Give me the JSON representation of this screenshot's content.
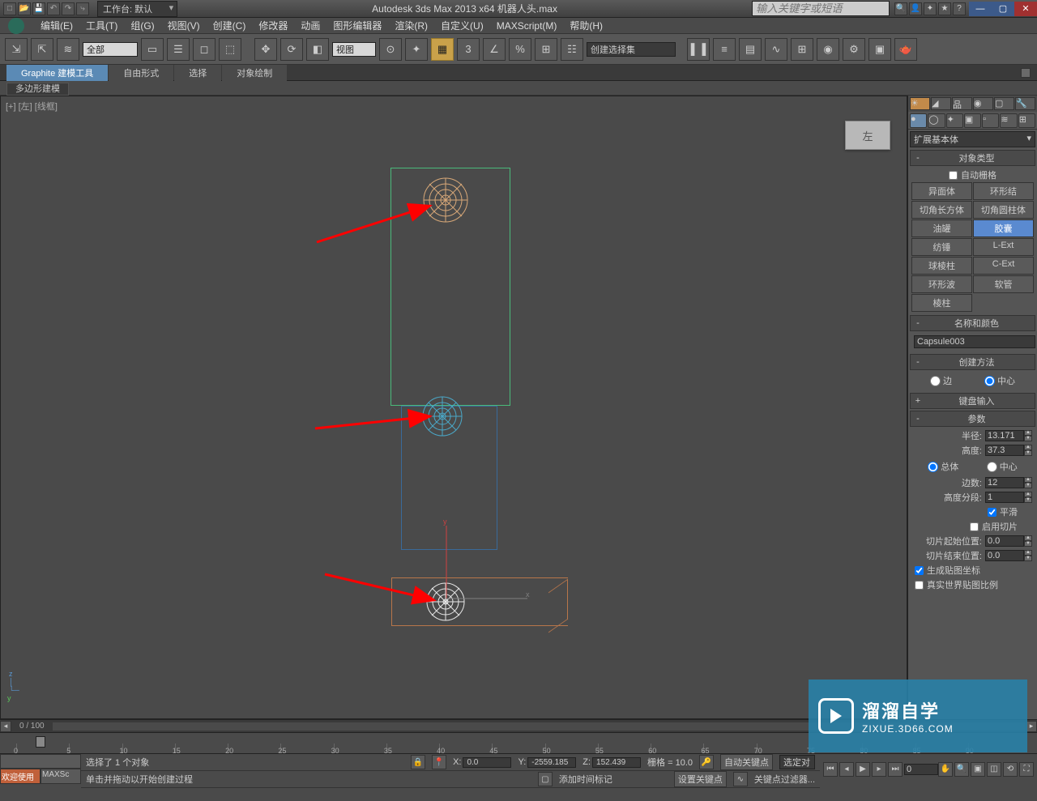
{
  "title": "Autodesk 3ds Max  2013 x64     机器人头.max",
  "workspace_label": "工作台: 默认",
  "search_placeholder": "输入关键字或短语",
  "menus": [
    "编辑(E)",
    "工具(T)",
    "组(G)",
    "视图(V)",
    "创建(C)",
    "修改器",
    "动画",
    "图形编辑器",
    "渲染(R)",
    "自定义(U)",
    "MAXScript(M)",
    "帮助(H)"
  ],
  "toolbar": {
    "filter_all": "全部",
    "viewport_drop": "视图",
    "named_sel": "创建选择集"
  },
  "ribbon_tabs": [
    "Graphite 建模工具",
    "自由形式",
    "选择",
    "对象绘制"
  ],
  "ribbon_sub": "多边形建模",
  "viewport_label": "[+] [左] [线框]",
  "viewcube_label": "左",
  "command_panel": {
    "category_drop": "扩展基本体",
    "rollouts": {
      "object_type": {
        "title": "对象类型",
        "autogrid": "自动栅格"
      },
      "name_color": {
        "title": "名称和颜色"
      },
      "create_method": {
        "title": "创建方法",
        "edge": "边",
        "center": "中心"
      },
      "keyboard": {
        "title": "键盘输入"
      },
      "params": {
        "title": "参数"
      }
    },
    "primitives": [
      [
        "异面体",
        "环形结"
      ],
      [
        "切角长方体",
        "切角圆柱体"
      ],
      [
        "油罐",
        "胶囊"
      ],
      [
        "纺锤",
        "L-Ext"
      ],
      [
        "球棱柱",
        "C-Ext"
      ],
      [
        "环形波",
        "软管"
      ],
      [
        "棱柱",
        ""
      ]
    ],
    "object_name": "Capsule003",
    "params": {
      "radius_label": "半径:",
      "radius": "13.171",
      "height_label": "高度:",
      "height": "37.3",
      "overall": "总体",
      "centers": "中心",
      "sides_label": "边数:",
      "sides": "12",
      "hsegs_label": "高度分段:",
      "hsegs": "1",
      "smooth": "平滑",
      "slice_on": "启用切片",
      "slice_from_label": "切片起始位置:",
      "slice_from": "0.0",
      "slice_to_label": "切片结束位置:",
      "slice_to": "0.0",
      "gen_uv": "生成贴图坐标",
      "real_world": "真实世界贴图比例"
    }
  },
  "trackbar_pos": "0 / 100",
  "status": {
    "line1": "选择了 1 个对象",
    "line2": "单击并拖动以开始创建过程",
    "x": "0.0",
    "y": "-2559.185",
    "z": "152.439",
    "grid": "栅格 = 10.0",
    "autokey": "自动关键点",
    "selset": "选定对",
    "setkey": "设置关键点",
    "keyfilter": "关键点过滤器...",
    "addtime": "添加时间标记",
    "welcome": "欢迎使用",
    "maxs": "MAXSc"
  },
  "watermark": {
    "big": "溜溜自学",
    "small": "ZIXUE.3D66.COM"
  },
  "timeline_ticks": [
    "0",
    "5",
    "10",
    "15",
    "20",
    "25",
    "30",
    "35",
    "40",
    "45",
    "50",
    "55",
    "60",
    "65",
    "70",
    "75",
    "80",
    "85",
    "90"
  ]
}
